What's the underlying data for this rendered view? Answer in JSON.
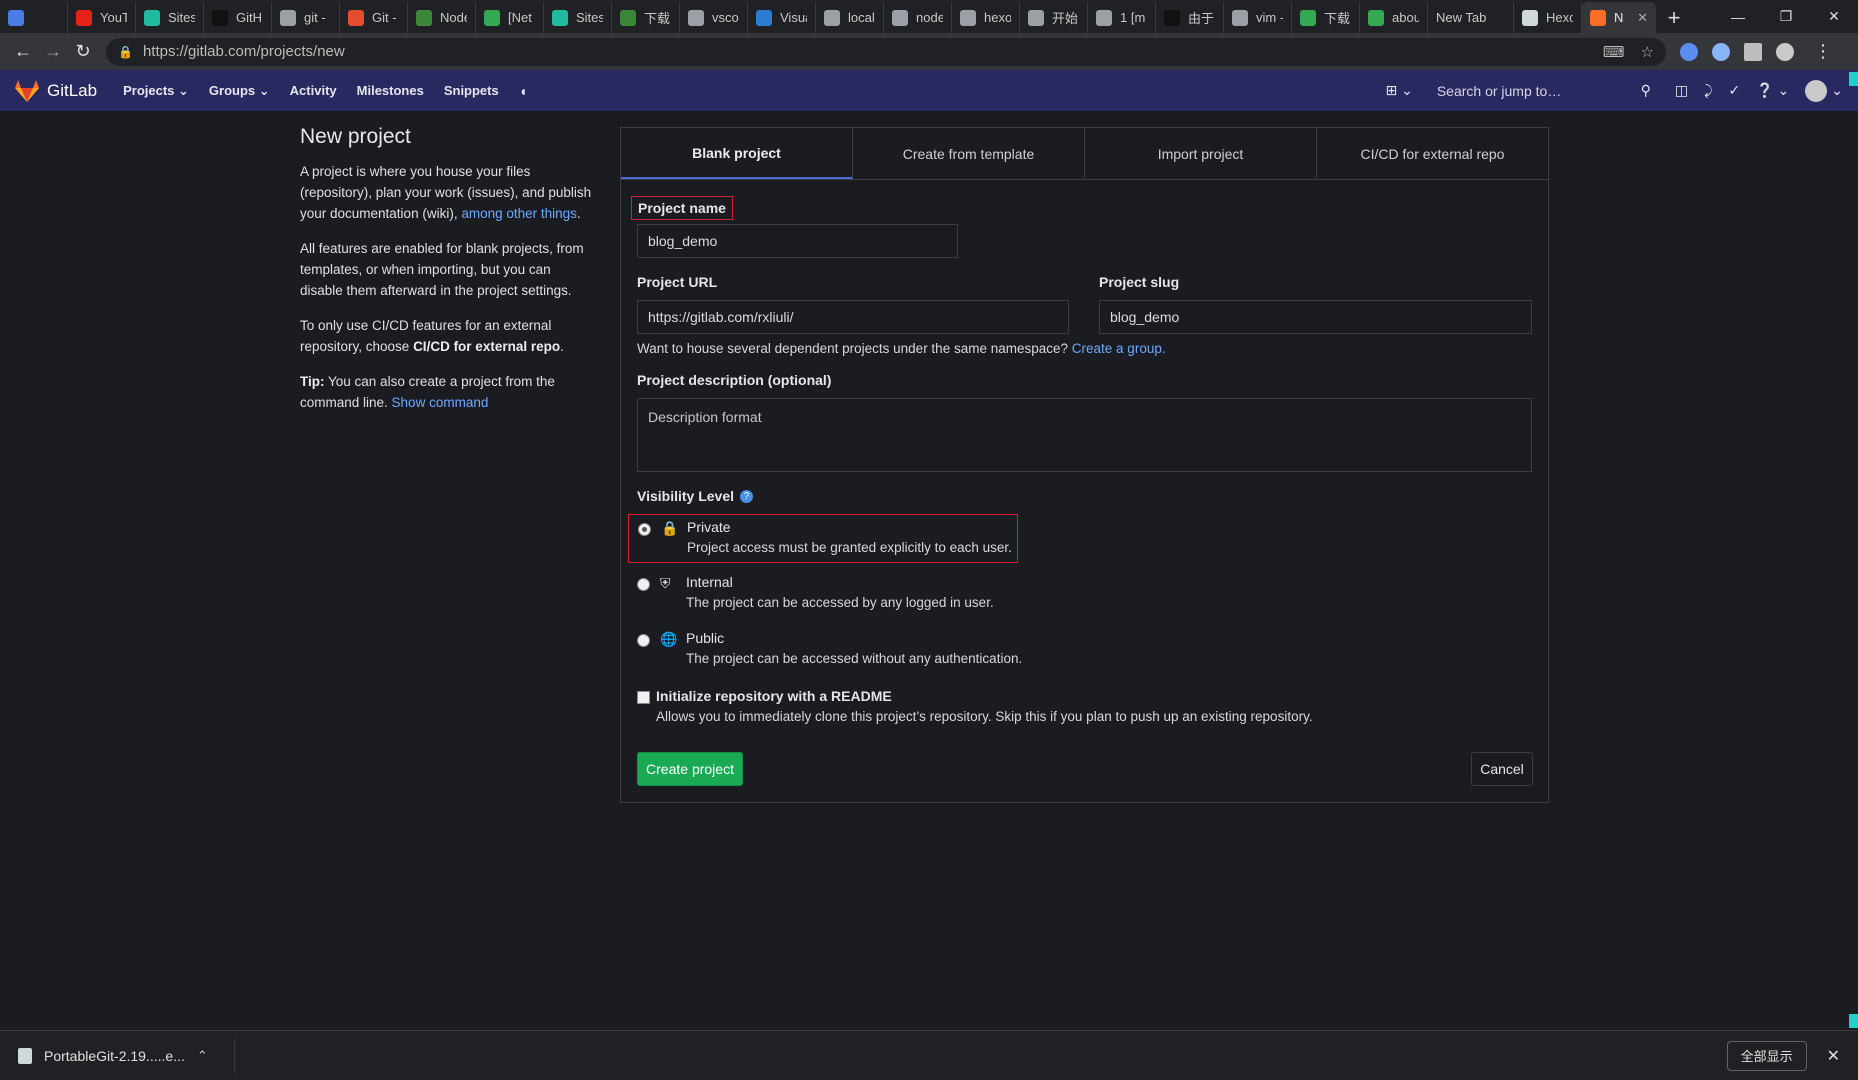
{
  "browser": {
    "tabs": [
      {
        "title": "",
        "color": "#4a7ee5"
      },
      {
        "title": "YouT",
        "color": "#e62117"
      },
      {
        "title": "Sites",
        "color": "#1fb9a0"
      },
      {
        "title": "GitH",
        "color": "#111111"
      },
      {
        "title": "git -",
        "color": "#9aa0a6"
      },
      {
        "title": "Git -",
        "color": "#e44c30"
      },
      {
        "title": "Node",
        "color": "#3c873a"
      },
      {
        "title": "[Net",
        "color": "#34a853"
      },
      {
        "title": "Sites",
        "color": "#1fb9a0"
      },
      {
        "title": "下载",
        "color": "#3c873a"
      },
      {
        "title": "vsco",
        "color": "#9aa0a6"
      },
      {
        "title": "Visua",
        "color": "#2b7cd3"
      },
      {
        "title": "local",
        "color": "#9aa0a6"
      },
      {
        "title": "node",
        "color": "#9aa0a6"
      },
      {
        "title": "hexo",
        "color": "#9aa0a6"
      },
      {
        "title": "开始",
        "color": "#9aa0a6"
      },
      {
        "title": "1 [m",
        "color": "#9aa0a6"
      },
      {
        "title": "由于",
        "color": "#111111"
      },
      {
        "title": "vim -",
        "color": "#9aa0a6"
      },
      {
        "title": "下载:",
        "color": "#34a853"
      },
      {
        "title": "abou",
        "color": "#34a853"
      },
      {
        "title": "New Tab",
        "color": ""
      },
      {
        "title": "Hexo",
        "color": "#cfd8dc"
      }
    ],
    "active_tab": {
      "title": "N",
      "close": "✕"
    },
    "new_tab": "+",
    "url": "https://gitlab.com/projects/new"
  },
  "gitlab_nav": {
    "brand": "GitLab",
    "menu": [
      "Projects",
      "Groups",
      "Activity",
      "Milestones",
      "Snippets"
    ],
    "search_placeholder": "Search or jump to…"
  },
  "intro": {
    "title": "New project",
    "p1_text": "A project is where you house your files (repository), plan your work (issues), and publish your documentation (wiki), ",
    "p1_link": "among other things",
    "p1_end": ".",
    "p2": "All features are enabled for blank projects, from templates, or when importing, but you can disable them afterward in the project settings.",
    "p3_text": "To only use CI/CD features for an external repository, choose ",
    "p3_bold": "CI/CD for external repo",
    "p3_end": ".",
    "tip_bold": "Tip:",
    "tip_text": " You can also create a project from the command line. ",
    "tip_link": "Show command"
  },
  "tabs": {
    "blank": "Blank project",
    "template": "Create from template",
    "import": "Import project",
    "cicd": "CI/CD for external repo"
  },
  "form": {
    "project_name_label": "Project name",
    "project_name_value": "blog_demo",
    "project_url_label": "Project URL",
    "project_url_value": "https://gitlab.com/rxliuli/",
    "project_slug_label": "Project slug",
    "project_slug_value": "blog_demo",
    "namespace_hint": "Want to house several dependent projects under the same namespace? ",
    "namespace_link": "Create a group.",
    "description_label": "Project description (optional)",
    "description_placeholder": "Description format",
    "visibility_label": "Visibility Level",
    "visibility_options": [
      {
        "label": "Private",
        "desc": "Project access must be granted explicitly to each user."
      },
      {
        "label": "Internal",
        "desc": "The project can be accessed by any logged in user."
      },
      {
        "label": "Public",
        "desc": "The project can be accessed without any authentication."
      }
    ],
    "readme_label": "Initialize repository with a README",
    "readme_desc": "Allows you to immediately clone this project’s repository. Skip this if you plan to push up an existing repository.",
    "create_button": "Create project",
    "cancel_button": "Cancel"
  },
  "downloads": {
    "file": "PortableGit-2.19.....e...",
    "show_all": "全部显示"
  }
}
